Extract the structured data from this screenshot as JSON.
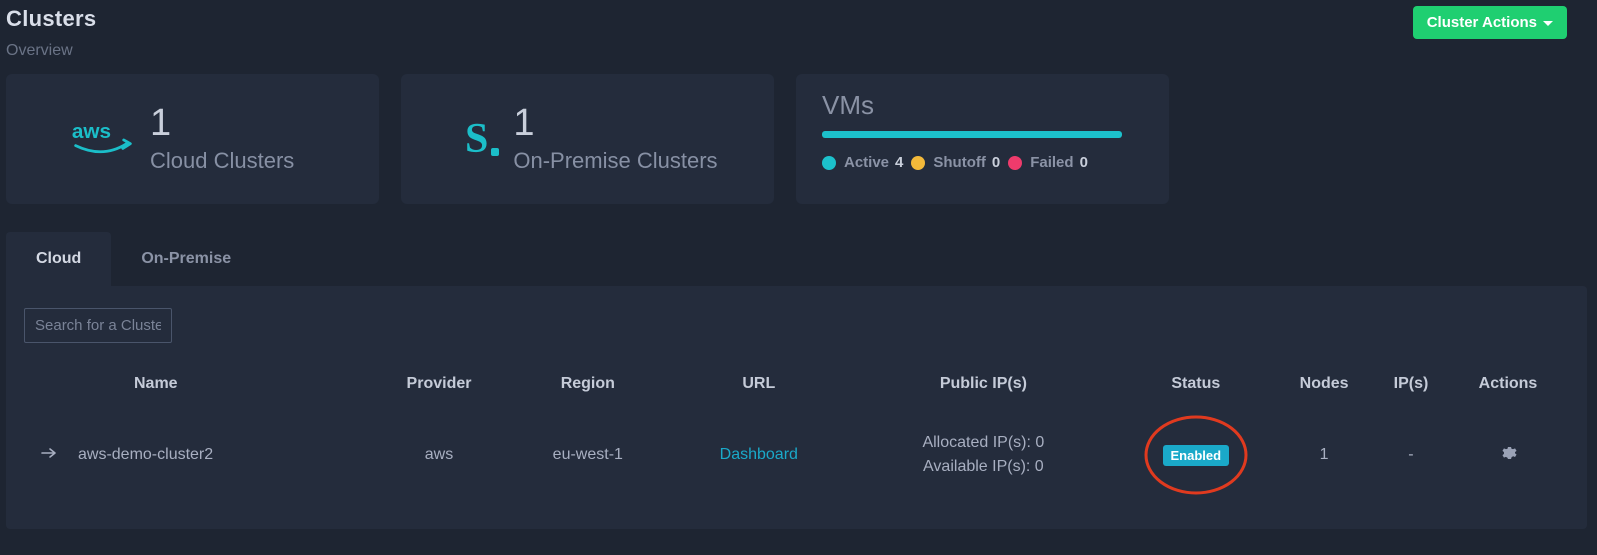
{
  "header": {
    "title": "Clusters",
    "overview_label": "Overview",
    "actions_button": "Cluster Actions"
  },
  "cards": {
    "cloud": {
      "count": "1",
      "label": "Cloud Clusters"
    },
    "onprem": {
      "count": "1",
      "label": "On-Premise Clusters"
    },
    "vms": {
      "title": "VMs",
      "active_label": "Active",
      "active_count": "4",
      "shutoff_label": "Shutoff",
      "shutoff_count": "0",
      "failed_label": "Failed",
      "failed_count": "0"
    }
  },
  "tabs": {
    "cloud": "Cloud",
    "onprem": "On-Premise"
  },
  "search": {
    "placeholder": "Search for a Cluster"
  },
  "table": {
    "headers": {
      "name": "Name",
      "provider": "Provider",
      "region": "Region",
      "url": "URL",
      "public_ips": "Public IP(s)",
      "status": "Status",
      "nodes": "Nodes",
      "ips": "IP(s)",
      "actions": "Actions"
    },
    "row": {
      "name": "aws-demo-cluster2",
      "provider": "aws",
      "region": "eu-west-1",
      "url_label": "Dashboard",
      "public_ips_allocated": "Allocated IP(s): 0",
      "public_ips_available": "Available IP(s): 0",
      "status_label": "Enabled",
      "nodes": "1",
      "ips": "-"
    }
  }
}
